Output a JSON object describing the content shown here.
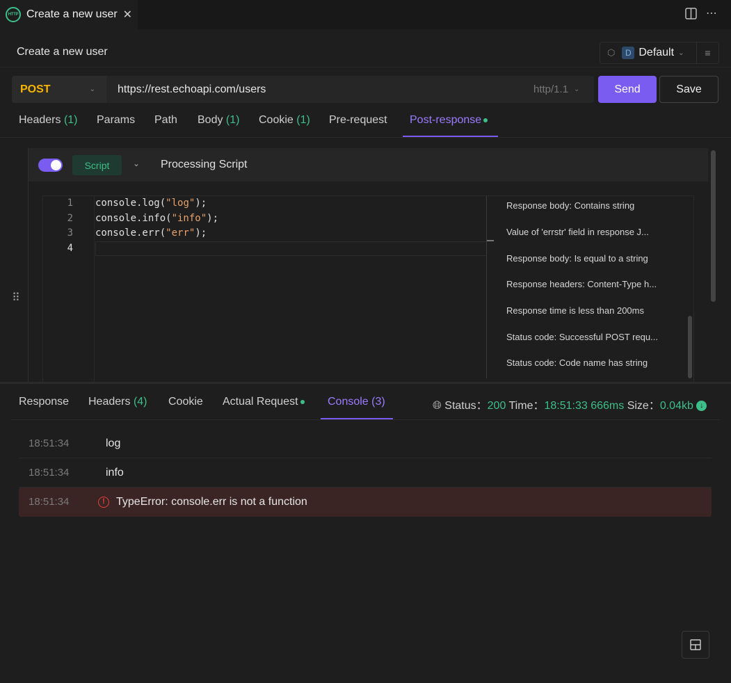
{
  "tab": {
    "icon": "http-icon",
    "title": "Create a new user"
  },
  "window": {
    "split_icon": "split-view-icon",
    "more_icon": "more-icon"
  },
  "request": {
    "title": "Create a new user",
    "environment": {
      "badge": "D",
      "name": "Default"
    },
    "method": "POST",
    "url": "https://rest.echoapi.com/users",
    "http_version": "http/1.1",
    "send_label": "Send",
    "save_label": "Save"
  },
  "req_tabs": [
    {
      "label": "Headers",
      "count": "(1)"
    },
    {
      "label": "Params",
      "count": ""
    },
    {
      "label": "Path",
      "count": ""
    },
    {
      "label": "Body",
      "count": "(1)"
    },
    {
      "label": "Cookie",
      "count": "(1)"
    },
    {
      "label": "Pre-request",
      "count": ""
    },
    {
      "label": "Post-response",
      "count": "",
      "active": true
    }
  ],
  "script": {
    "tag": "Script",
    "title": "Processing Script",
    "enabled": true,
    "lines": [
      {
        "num": "1",
        "prefix": "console.log(",
        "str": "\"log\"",
        "suffix": ");"
      },
      {
        "num": "2",
        "prefix": "console.info(",
        "str": "\"info\"",
        "suffix": ");"
      },
      {
        "num": "3",
        "prefix": "console.err(",
        "str": "\"err\"",
        "suffix": ");"
      },
      {
        "num": "4",
        "prefix": "",
        "str": "",
        "suffix": ""
      }
    ],
    "snippets": [
      "Response body: Contains string",
      "Value of 'errstr' field in response J...",
      "Response body: Is equal to a string",
      "Response headers: Content-Type h...",
      "Response time is less than 200ms",
      "Status code: Successful POST requ...",
      "Status code: Code name has string"
    ]
  },
  "resp_tabs": [
    {
      "label": "Response",
      "count": ""
    },
    {
      "label": "Headers",
      "count": "(4)"
    },
    {
      "label": "Cookie",
      "count": ""
    },
    {
      "label": "Actual Request",
      "count": ""
    },
    {
      "label": "Console",
      "count": "(3)",
      "active": true
    }
  ],
  "status": {
    "status_label": "Status：",
    "status_value": "200",
    "time_label": "Time：",
    "time_value": "18:51:33",
    "duration": "666ms",
    "size_label": "Size：",
    "size_value": "0.04kb"
  },
  "console": [
    {
      "time": "18:51:34",
      "message": "log",
      "level": "log"
    },
    {
      "time": "18:51:34",
      "message": "info",
      "level": "info"
    },
    {
      "time": "18:51:34",
      "message": "TypeError: console.err is not a function",
      "level": "error"
    }
  ],
  "colors": {
    "accent": "#7b5cf0",
    "success": "#3dbf8a",
    "method": "#f7b500",
    "error": "#e0443a"
  }
}
